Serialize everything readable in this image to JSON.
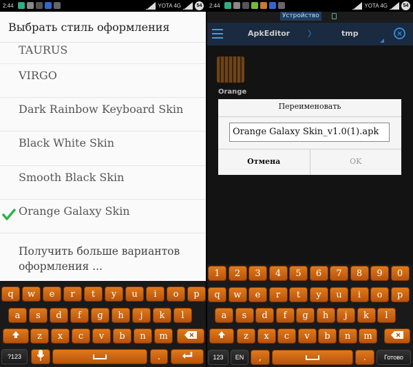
{
  "status_left": {
    "time": "2:44",
    "carrier": "YOTA 4G",
    "battery": "54"
  },
  "status_right": {
    "time": "2:44",
    "carrier": "YOTA 4G",
    "battery": "54"
  },
  "left": {
    "title": "Выбрать стиль оформления",
    "items": [
      {
        "label": "TAURUS"
      },
      {
        "label": "VIRGO"
      },
      {
        "label": "Dark Rainbow Keyboard Skin"
      },
      {
        "label": "Black White Skin"
      },
      {
        "label": "Smooth Black Skin"
      },
      {
        "label": "Orange Galaxy Skin",
        "selected": true
      }
    ],
    "more": "Получить больше вариантов оформления ..."
  },
  "right": {
    "device_tab": "Устройство",
    "app_title": "ApkEditor",
    "path_sep": "〉",
    "folder": "tmp",
    "file_label": "Orange",
    "dialog": {
      "title": "Переименовать",
      "input_value": "Orange Galaxy Skin_v1.0(1).apk",
      "cancel": "Отмена",
      "ok": "OK"
    }
  },
  "keyboard_left": {
    "row1": [
      "q",
      "w",
      "e",
      "r",
      "t",
      "y",
      "u",
      "i",
      "o",
      "p"
    ],
    "row2": [
      "a",
      "s",
      "d",
      "f",
      "g",
      "h",
      "j",
      "k",
      "l"
    ],
    "row3": [
      "z",
      "x",
      "c",
      "v",
      "b",
      "n",
      "m"
    ],
    "symbols": "?123",
    "period": "."
  },
  "keyboard_right": {
    "digits": [
      "1",
      "2",
      "3",
      "4",
      "5",
      "6",
      "7",
      "8",
      "9",
      "0"
    ],
    "row1": [
      "q",
      "w",
      "e",
      "r",
      "t",
      "y",
      "u",
      "i",
      "o",
      "p"
    ],
    "row2": [
      "a",
      "s",
      "d",
      "f",
      "g",
      "h",
      "j",
      "k",
      "l"
    ],
    "row3": [
      "z",
      "x",
      "c",
      "v",
      "b",
      "n",
      "m"
    ],
    "symbols": "123",
    "lang": "EN",
    "comma": ",",
    "period": ".",
    "done": "Готово"
  },
  "colors": {
    "accent": "#2e8cd8",
    "key_orange": "#d06a12",
    "check_green": "#2bb34a"
  }
}
